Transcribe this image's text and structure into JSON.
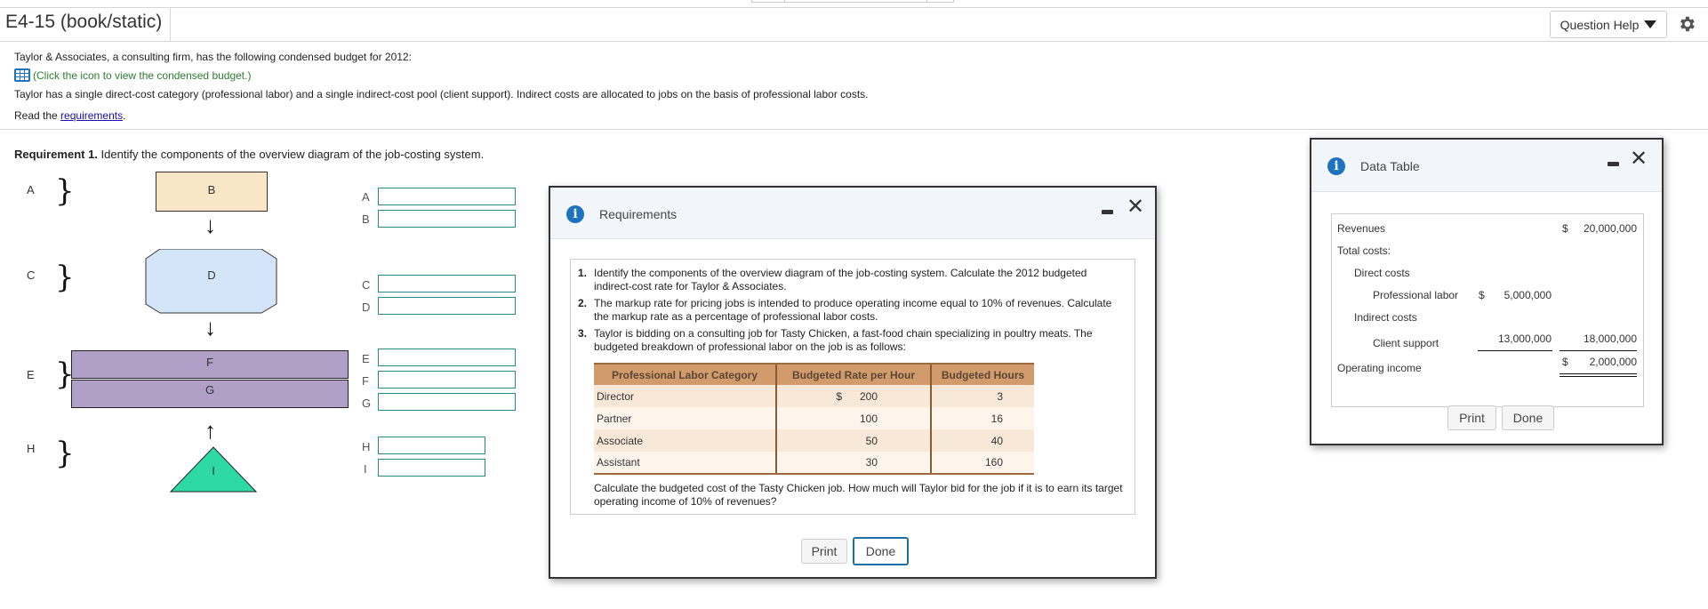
{
  "header": {
    "title": "E4-15 (book/static)",
    "question_help": "Question Help"
  },
  "intro": {
    "line1": "Taylor & Associates, a consulting firm, has the following condensed budget for 2012:",
    "icon_link": "(Click the icon to view the condensed budget.)",
    "line2": "Taylor has a single direct-cost category (professional labor) and a single indirect-cost pool (client support). Indirect costs are allocated to jobs on the basis of professional labor costs.",
    "read_prefix": "Read the ",
    "read_link": "requirements",
    "read_suffix": "."
  },
  "requirement1": {
    "bold": "Requirement 1.",
    "text": " Identify the components of the overview diagram of the job-costing system."
  },
  "diagram": {
    "brace_labels": [
      "A",
      "C",
      "E",
      "H"
    ],
    "shape_labels": {
      "B": "B",
      "D": "D",
      "F": "F",
      "G": "G",
      "I": "I"
    },
    "answer_fields": [
      {
        "label": "A",
        "value": ""
      },
      {
        "label": "B",
        "value": ""
      },
      {
        "label": "C",
        "value": ""
      },
      {
        "label": "D",
        "value": ""
      },
      {
        "label": "E",
        "value": ""
      },
      {
        "label": "F",
        "value": ""
      },
      {
        "label": "G",
        "value": ""
      },
      {
        "label": "H",
        "value": ""
      },
      {
        "label": "I",
        "value": ""
      }
    ]
  },
  "requirements_modal": {
    "title": "Requirements",
    "items": [
      {
        "num": "1.",
        "text": "Identify the components of the overview diagram of the job-costing system. Calculate the 2012 budgeted indirect-cost rate for Taylor & Associates."
      },
      {
        "num": "2.",
        "text": "The markup rate for pricing jobs is intended to produce operating income equal to 10% of revenues. Calculate the markup rate as a percentage of professional labor costs."
      },
      {
        "num": "3.",
        "text": "Taylor is bidding on a consulting job for Tasty Chicken, a fast-food chain specializing in poultry meats. The budgeted breakdown of professional labor on the job is as follows:"
      }
    ],
    "table": {
      "headers": [
        "Professional Labor Category",
        "Budgeted Rate per Hour",
        "Budgeted Hours"
      ],
      "rows": [
        {
          "category": "Director",
          "currency": "$",
          "rate": "200",
          "hours": "3"
        },
        {
          "category": "Partner",
          "currency": "",
          "rate": "100",
          "hours": "16"
        },
        {
          "category": "Associate",
          "currency": "",
          "rate": "50",
          "hours": "40"
        },
        {
          "category": "Assistant",
          "currency": "",
          "rate": "30",
          "hours": "160"
        }
      ]
    },
    "tail": "Calculate the budgeted cost of the Tasty Chicken job. How much will Taylor bid for the job if it is to earn its target operating income of 10% of revenues?",
    "print_label": "Print",
    "done_label": "Done"
  },
  "data_table_modal": {
    "title": "Data Table",
    "rows": {
      "revenues": {
        "label": "Revenues",
        "cur": "$",
        "value": "20,000,000"
      },
      "total_costs": {
        "label": "Total costs:"
      },
      "direct_costs": {
        "label": "Direct costs"
      },
      "professional_labor": {
        "label": "Professional labor",
        "cur": "$",
        "value": "5,000,000"
      },
      "indirect_costs": {
        "label": "Indirect costs"
      },
      "client_support": {
        "label": "Client support",
        "value": "13,000,000",
        "total": "18,000,000"
      },
      "operating_income": {
        "label": "Operating income",
        "cur": "$",
        "value": "2,000,000"
      }
    },
    "print_label": "Print",
    "done_label": "Done"
  },
  "colors": {
    "link": "#1a0dab",
    "green_link": "#2e7d32",
    "info_blue": "#1e73be",
    "table_header": "#d29b6b",
    "input_border": "#2a8a8a"
  }
}
